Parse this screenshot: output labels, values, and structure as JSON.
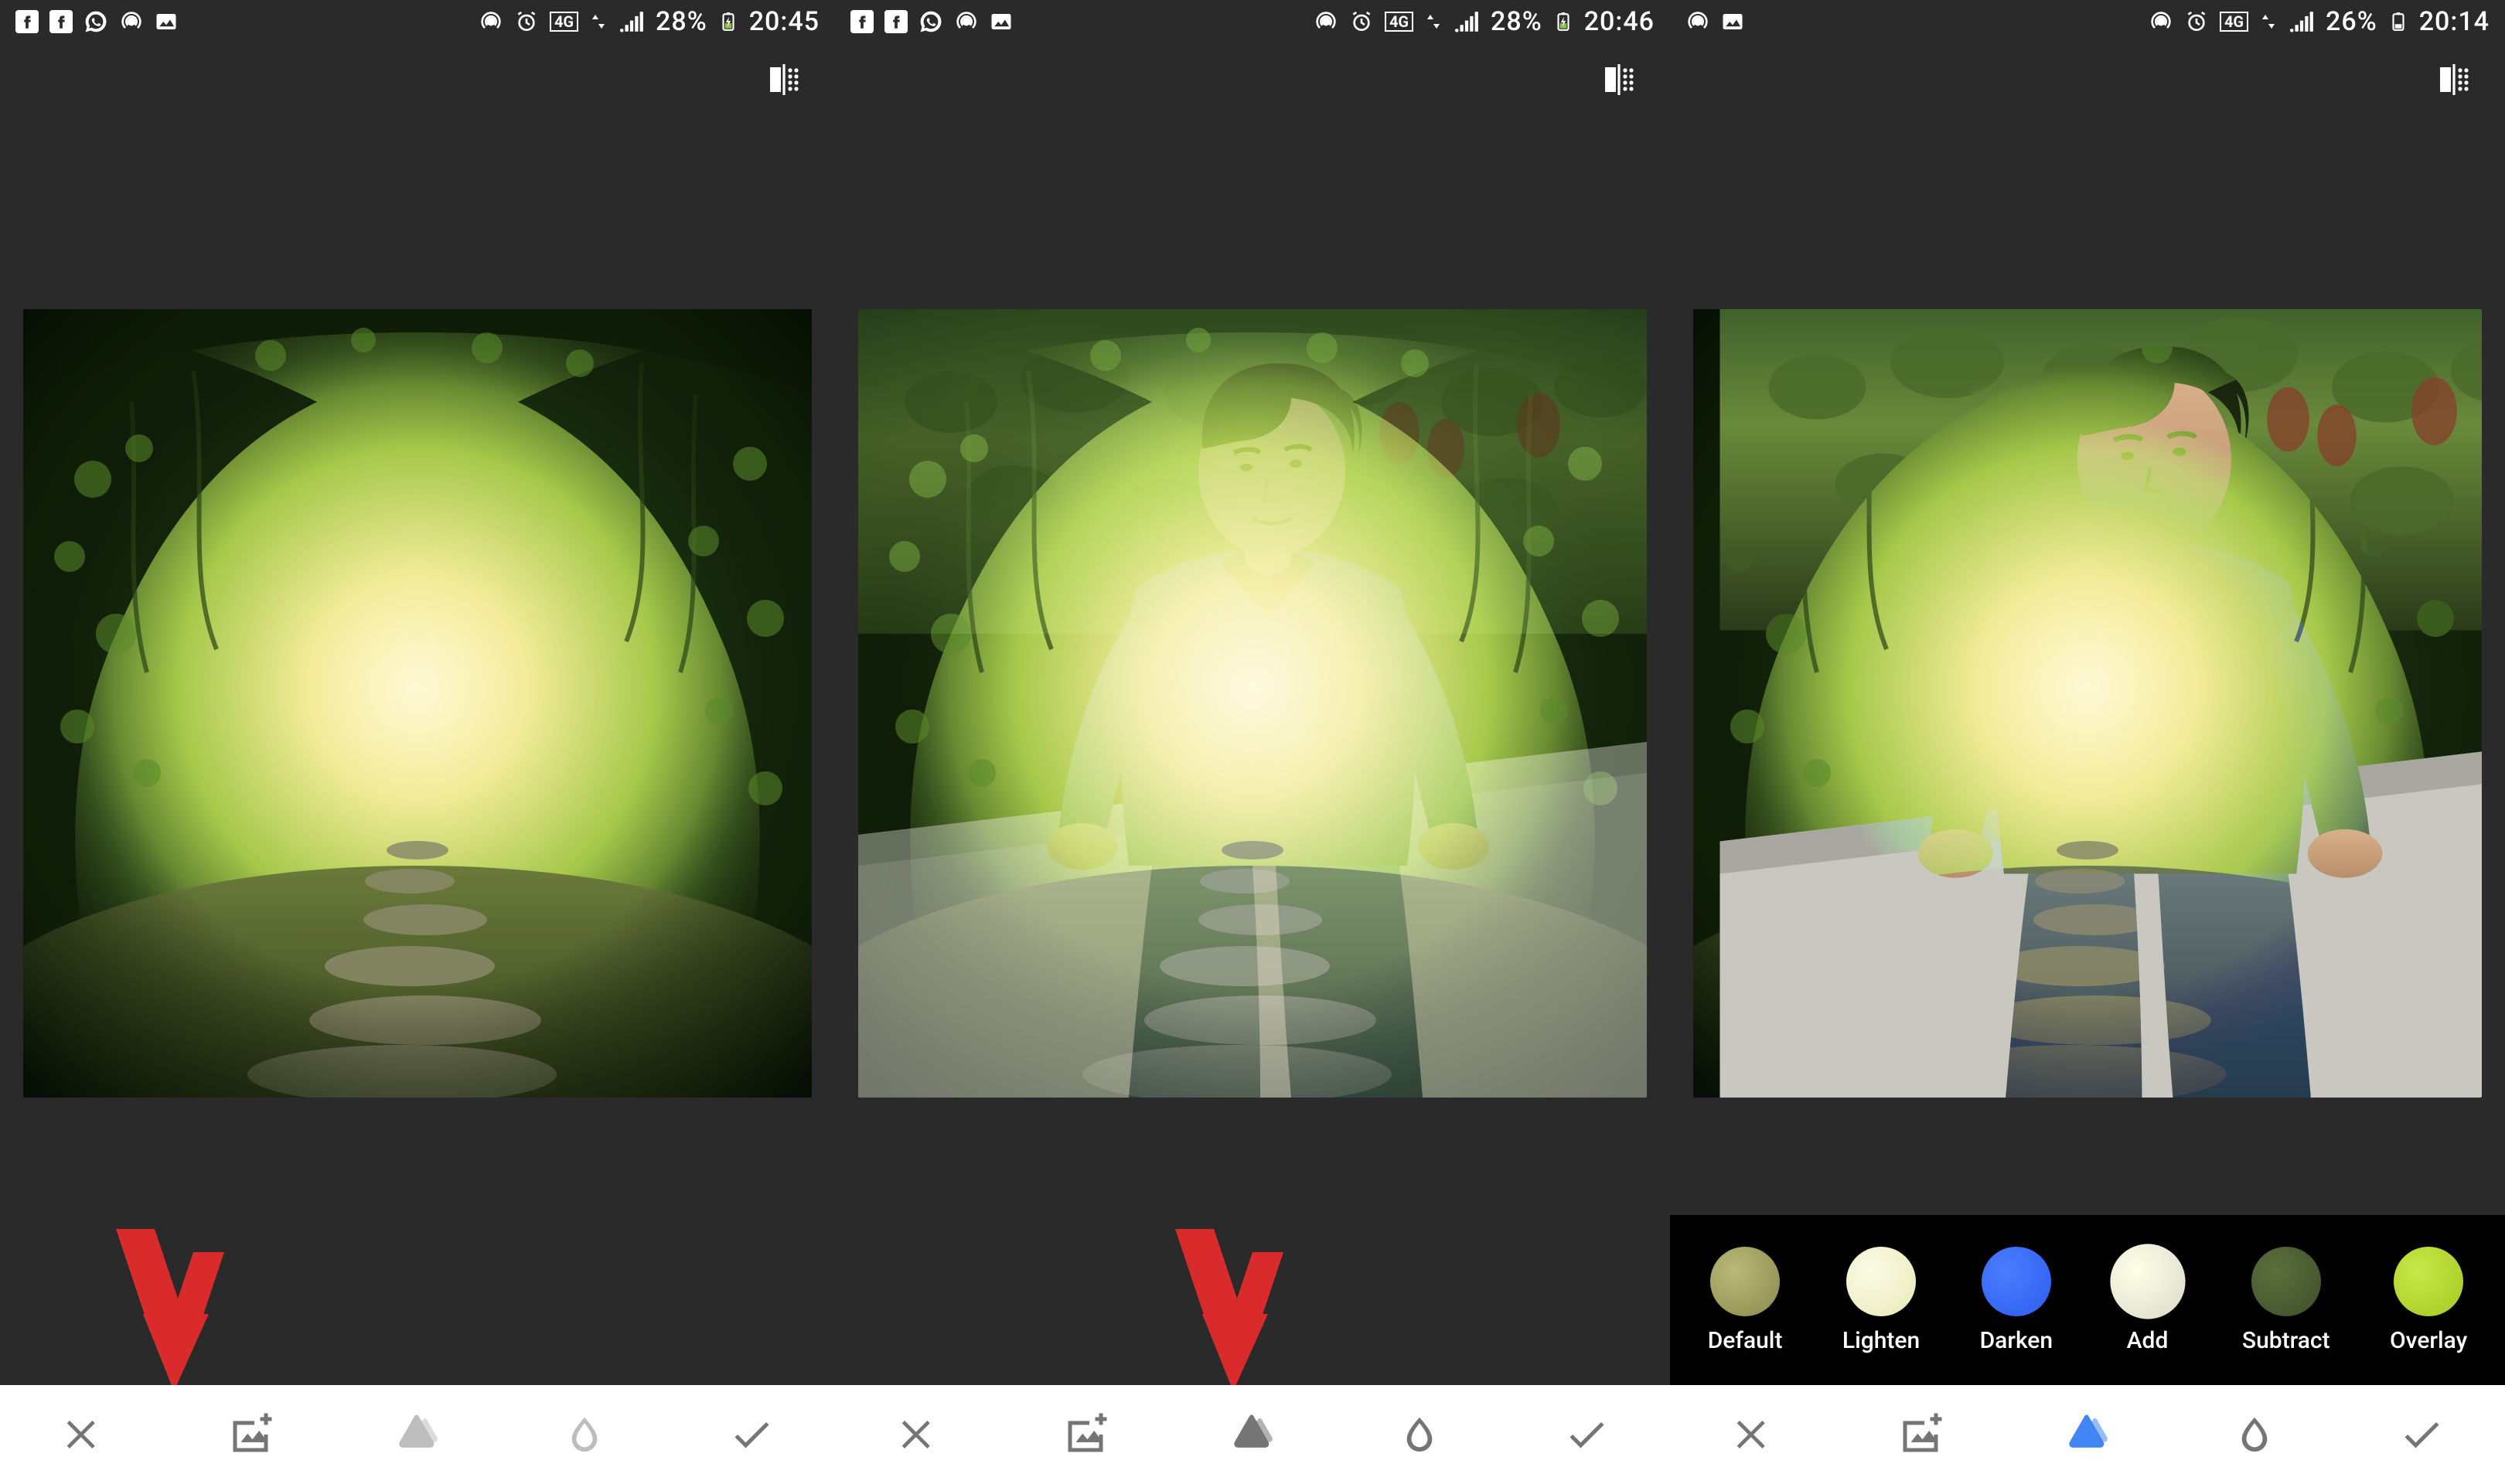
{
  "panels": [
    {
      "status": {
        "battery": "28%",
        "clock": "20:45",
        "network": "4G"
      },
      "blendbar_visible": false,
      "arrow_target": "add-image",
      "tools": [
        {
          "name": "cancel",
          "active": false
        },
        {
          "name": "add-image",
          "active": false,
          "highlighted": true
        },
        {
          "name": "styles",
          "active": false
        },
        {
          "name": "opacity",
          "active": false
        },
        {
          "name": "confirm",
          "active": false
        }
      ]
    },
    {
      "status": {
        "battery": "28%",
        "clock": "20:46",
        "network": "4G"
      },
      "blendbar_visible": false,
      "arrow_target": "styles",
      "tools": [
        {
          "name": "cancel",
          "active": false
        },
        {
          "name": "add-image",
          "active": false
        },
        {
          "name": "styles",
          "active": false,
          "highlighted": true
        },
        {
          "name": "opacity",
          "active": false
        },
        {
          "name": "confirm",
          "active": false
        }
      ]
    },
    {
      "status": {
        "battery": "26%",
        "clock": "20:14",
        "network": "4G"
      },
      "blendbar_visible": true,
      "blend_modes": [
        {
          "label": "Default",
          "color_a": "#8a8a4d",
          "color_b": "#b9b978",
          "selected": false
        },
        {
          "label": "Lighten",
          "color_a": "#e9e9b8",
          "color_b": "#fbfbe6",
          "selected": false
        },
        {
          "label": "Darken",
          "color_a": "#2d5df0",
          "color_b": "#4a7dff",
          "selected": false
        },
        {
          "label": "Add",
          "color_a": "#d9d9c8",
          "color_b": "#ffffe8",
          "selected": true
        },
        {
          "label": "Subtract",
          "color_a": "#3f4f2a",
          "color_b": "#5a6f3c",
          "selected": false
        },
        {
          "label": "Overlay",
          "color_a": "#a6c71f",
          "color_b": "#c9e84a",
          "selected": false
        }
      ],
      "tools": [
        {
          "name": "cancel",
          "active": false
        },
        {
          "name": "add-image",
          "active": false
        },
        {
          "name": "styles",
          "active": true
        },
        {
          "name": "opacity",
          "active": false
        },
        {
          "name": "confirm",
          "active": false
        }
      ]
    }
  ],
  "icons": {
    "compare": "compare-icon",
    "cancel": "close-icon",
    "add-image": "add-image-icon",
    "styles": "styles-icon",
    "opacity": "opacity-icon",
    "confirm": "check-icon"
  },
  "colors": {
    "accent": "#4285f4",
    "tool_gray": "#757575",
    "bg_dark": "#2a2a2a",
    "arrow_red": "#d92b2b"
  }
}
